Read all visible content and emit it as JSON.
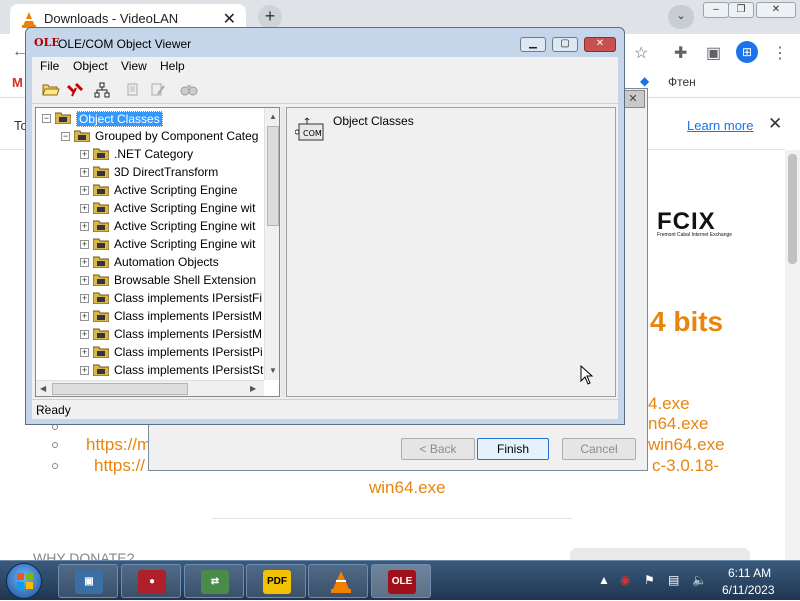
{
  "browser": {
    "tab_title": "Downloads - VideoLAN",
    "tab_close": "✕",
    "new_tab": "+",
    "tab_search": "⌄",
    "bookmark_right": "Фтен",
    "cookie_prefix": "To",
    "learn_more": "Learn more",
    "cookie_close": "✕",
    "profile_icon": "profile-avatar"
  },
  "webpage": {
    "sponsor_logo": "FCIX",
    "sponsor_sub": "Fremont Cabal Internet Exchange",
    "heading_bits": "4 bits",
    "links": [
      "4.exe",
      "n64.exe",
      "https://m",
      "win64.exe",
      "https://",
      "c-3.0.18-",
      "win64.exe"
    ],
    "why_donate": "WHY DONATE?"
  },
  "wizard": {
    "close": "✕",
    "back": "< Back",
    "finish": "Finish",
    "cancel": "Cancel"
  },
  "ole_window": {
    "title": "OLE/COM Object Viewer",
    "icon_text": "OLE",
    "controls": {
      "minimize": "▁",
      "maximize": "▢",
      "close": "✕"
    },
    "menu": [
      "File",
      "Object",
      "View",
      "Help"
    ],
    "toolbar_icons": [
      "open-folder-icon",
      "unbind-icon",
      "hierarchy-icon",
      "copy-icon",
      "edit-icon",
      "binoculars-icon"
    ],
    "tree": {
      "root": "Object Classes",
      "group": "Grouped by Component Categ",
      "items": [
        ".NET Category",
        "3D DirectTransform",
        "Active Scripting Engine",
        "Active Scripting Engine wit",
        "Active Scripting Engine wit",
        "Active Scripting Engine wit",
        "Automation Objects",
        "Browsable Shell Extension",
        "Class implements IPersistFi",
        "Class implements IPersistM",
        "Class implements IPersistM",
        "Class implements IPersistPi",
        "Class implements IPersistSt"
      ]
    },
    "detail": {
      "label": "Object Classes",
      "icon_text": "COM"
    },
    "status": "Ready"
  },
  "taskbar": {
    "apps": [
      "remote-desktop-icon",
      "screen-recorder-icon",
      "network-icon",
      "pdf-icon",
      "vlc-icon",
      "ole-viewer-icon"
    ],
    "pdf_label": "PDF",
    "ole_label": "OLE",
    "time": "6:11 AM",
    "date": "6/11/2023"
  }
}
